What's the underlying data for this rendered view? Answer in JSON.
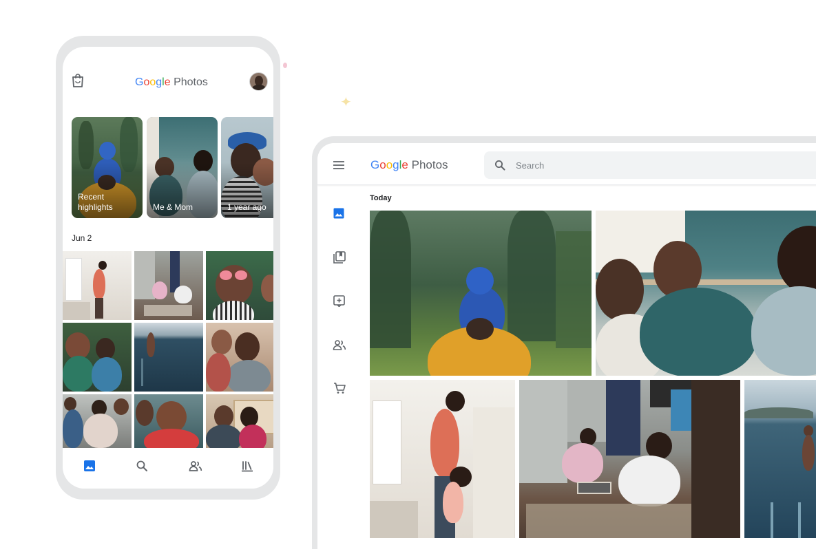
{
  "phone": {
    "title": {
      "g": "G",
      "o1": "o",
      "o2": "o",
      "g2": "g",
      "l": "l",
      "e": "e",
      "rest": " Photos"
    },
    "highlights": [
      {
        "label": "Recent highlights"
      },
      {
        "label": "Me & Mom"
      },
      {
        "label": "1 year ago"
      }
    ],
    "date_label": "Jun 2"
  },
  "tablet": {
    "title": {
      "g": "G",
      "o1": "o",
      "o2": "o",
      "g2": "g",
      "l": "l",
      "e": "e",
      "rest": " Photos"
    },
    "search_placeholder": "Search",
    "section_label": "Today"
  },
  "colors": {
    "accent": "#1a73e8",
    "icon_gray": "#5f6368",
    "frame": "#e5e6e7"
  }
}
